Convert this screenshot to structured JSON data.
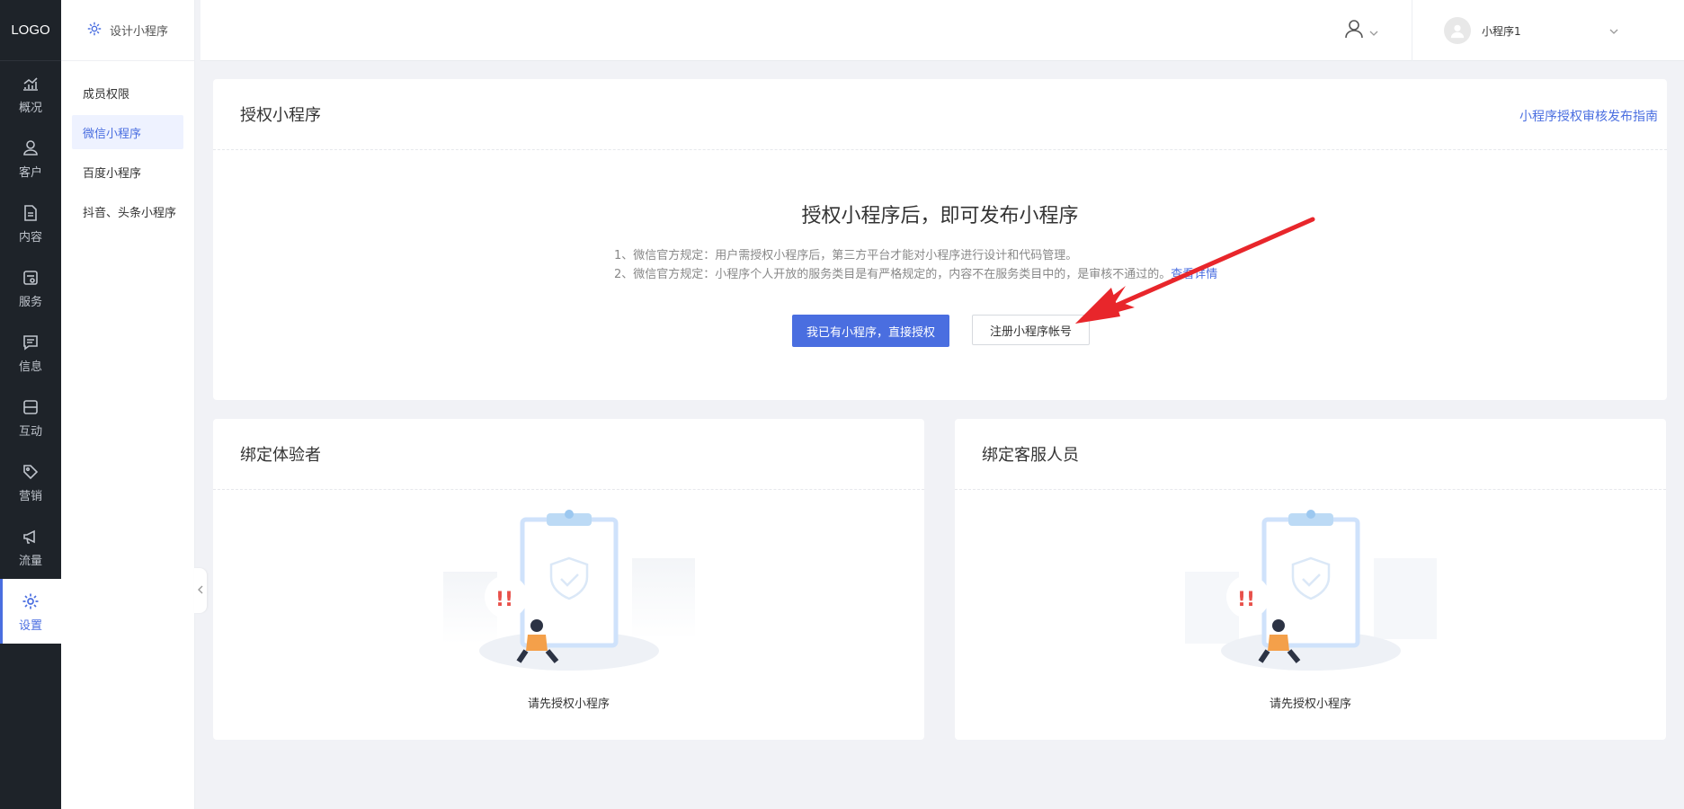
{
  "logo": "LOGO",
  "nav": {
    "items": [
      {
        "label": "概况",
        "icon": "chart-line-icon"
      },
      {
        "label": "客户",
        "icon": "user-icon"
      },
      {
        "label": "内容",
        "icon": "document-icon"
      },
      {
        "label": "服务",
        "icon": "service-icon"
      },
      {
        "label": "信息",
        "icon": "message-icon"
      },
      {
        "label": "互动",
        "icon": "game-icon"
      },
      {
        "label": "营销",
        "icon": "tag-icon"
      },
      {
        "label": "流量",
        "icon": "megaphone-icon"
      },
      {
        "label": "设置",
        "icon": "gear-icon"
      }
    ],
    "active_index": 8
  },
  "subnav": {
    "title": "设计小程序",
    "items": [
      {
        "label": "成员权限"
      },
      {
        "label": "微信小程序"
      },
      {
        "label": "百度小程序"
      },
      {
        "label": "抖音、头条小程序"
      }
    ],
    "active_index": 1
  },
  "header": {
    "account_name": "小程序1"
  },
  "auth_card": {
    "title": "授权小程序",
    "guide_link": "小程序授权审核发布指南",
    "heading": "授权小程序后，即可发布小程序",
    "rule1": "1、微信官方规定：用户需授权小程序后，第三方平台才能对小程序进行设计和代码管理。",
    "rule2": "2、微信官方规定：小程序个人开放的服务类目是有严格规定的，内容不在服务类目中的，是审核不通过的。",
    "rule2_link": "查看详情",
    "primary_button": "我已有小程序，直接授权",
    "secondary_button": "注册小程序帐号"
  },
  "tester_card": {
    "title": "绑定体验者",
    "empty_text": "请先授权小程序"
  },
  "service_card": {
    "title": "绑定客服人员",
    "empty_text": "请先授权小程序"
  },
  "colors": {
    "accent": "#4a6ee0",
    "nav_bg": "#1e2329",
    "annotation_arrow": "#e8262b"
  }
}
